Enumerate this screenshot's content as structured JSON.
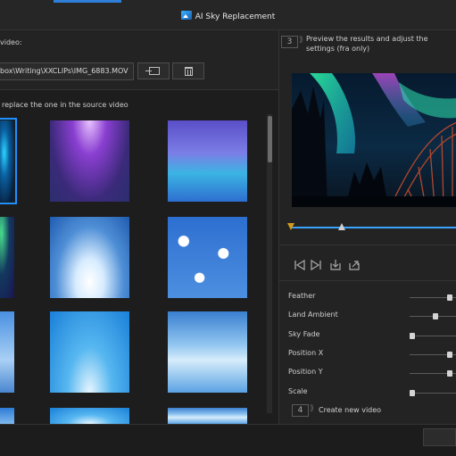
{
  "window": {
    "title": "AI Sky Replacement"
  },
  "step_source": {
    "label": "video:",
    "path": "box\\Writing\\XXCLIPs\\IMG_6883.MOV"
  },
  "step_sky": {
    "label": "replace the one in the source video"
  },
  "step_preview": {
    "number": "3",
    "label": "Preview the results and adjust the settings (fra only)"
  },
  "thumbnails": [
    {
      "name": "aurora-selected",
      "selected": true
    },
    {
      "name": "aurora-purple",
      "selected": false
    },
    {
      "name": "aurora-blue",
      "selected": false
    },
    {
      "name": "aurora-green",
      "selected": false
    },
    {
      "name": "clouds-1",
      "selected": false
    },
    {
      "name": "clouds-2",
      "selected": false
    },
    {
      "name": "clouds-3",
      "selected": false
    },
    {
      "name": "sky-1",
      "selected": false
    },
    {
      "name": "sky-2",
      "selected": false
    }
  ],
  "playback_controls": [
    "prev-frame-icon",
    "next-frame-icon",
    "mark-in-icon",
    "mark-out-icon"
  ],
  "settings": [
    {
      "label": "Feather",
      "value": 0.9
    },
    {
      "label": "Land Ambient",
      "value": 0.55
    },
    {
      "label": "Sky Fade",
      "value": 0.0
    },
    {
      "label": "Position X",
      "value": 0.9
    },
    {
      "label": "Position Y",
      "value": 0.9
    },
    {
      "label": "Scale",
      "value": 0.0
    }
  ],
  "step_create": {
    "number": "4",
    "label": "Create new video"
  },
  "colors": {
    "accent": "#2f7fd8",
    "selection": "#1e90ff",
    "timeline": "#3aa2ff",
    "timeline_start": "#d49b1a"
  }
}
